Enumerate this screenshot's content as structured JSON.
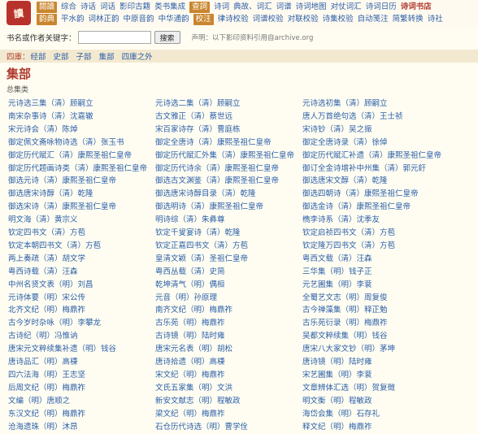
{
  "logo": {
    "text": "讀"
  },
  "nav": {
    "row1": [
      {
        "label": "閱讀",
        "style": "tag"
      },
      {
        "label": "综合",
        "style": ""
      },
      {
        "label": "诗话",
        "style": ""
      },
      {
        "label": "词话",
        "style": ""
      },
      {
        "label": "影印古籍",
        "style": ""
      },
      {
        "label": "类书集成",
        "style": ""
      },
      {
        "label": "查詞",
        "style": "tag"
      },
      {
        "label": "诗词",
        "style": ""
      },
      {
        "label": "典故、词汇",
        "style": ""
      },
      {
        "label": "词谱",
        "style": ""
      },
      {
        "label": "诗词地图",
        "style": ""
      },
      {
        "label": "对仗词汇",
        "style": ""
      },
      {
        "label": "诗词日历",
        "style": ""
      },
      {
        "label": "诗词书店",
        "style": "strong"
      }
    ],
    "row2": [
      {
        "label": "韵典",
        "style": "tag"
      },
      {
        "label": "平水韵",
        "style": ""
      },
      {
        "label": "词林正韵",
        "style": ""
      },
      {
        "label": "中原音韵",
        "style": ""
      },
      {
        "label": "中华通韵",
        "style": ""
      },
      {
        "label": "校注",
        "style": "tag"
      },
      {
        "label": "律诗校验",
        "style": ""
      },
      {
        "label": "词谱校验",
        "style": ""
      },
      {
        "label": "对联校验",
        "style": ""
      },
      {
        "label": "诗集校验",
        "style": ""
      },
      {
        "label": "自动笺注",
        "style": ""
      },
      {
        "label": "简繁转换",
        "style": ""
      },
      {
        "label": "诗社",
        "style": ""
      }
    ]
  },
  "search": {
    "label": "书名或作者关键字：",
    "value": "",
    "button": "搜索",
    "notice": "声明：以下影印资料引用自archive.org"
  },
  "categories": {
    "label": "四庫：",
    "items": [
      "经部",
      "史部",
      "子部",
      "集部",
      "四庫之外"
    ]
  },
  "page": {
    "title": "集部",
    "section": "总集类"
  },
  "books": [
    [
      "元诗选三集（清）顾嗣立",
      "元诗选二集（清）顾嗣立",
      "元诗选初集（清）顾嗣立"
    ],
    [
      "南宋杂事诗（清）沈嘉辙",
      "古文雅正（清）蔡世远",
      "唐人万首绝句选（清）王士祯"
    ],
    [
      "宋元诗会（清）陈焯",
      "宋百家诗存（清）曹庭栋",
      "宋诗钞（清）吴之振"
    ],
    [
      "御定佩文斋咏物诗选（清）张玉书",
      "御定全唐诗（清）康熙圣祖仁皇帝",
      "御定全唐诗录（清）徐倬"
    ],
    [
      "御定历代赋汇（清）康熙圣祖仁皇帝",
      "御定历代赋汇外集（清）康熙圣祖仁皇帝",
      "御定历代赋汇补遗（清）康熙圣祖仁皇帝"
    ],
    [
      "御定历代题画诗类（清）康熙圣祖仁皇帝",
      "御定历代诗余（清）康熙圣祖仁皇帝",
      "御订全金诗增补中州集（清）郭元釪"
    ],
    [
      "御选元诗（清）康熙圣祖仁皇帝",
      "御选古文渊鉴（清）康熙圣祖仁皇帝",
      "御选唐宋文醇（清）乾隆"
    ],
    [
      "御选唐宋诗醇（清）乾隆",
      "御选唐宋诗醇目录（清）乾隆",
      "御选四朝诗（清）康熙圣祖仁皇帝"
    ],
    [
      "御选宋诗（清）康熙圣祖仁皇帝",
      "御选明诗（清）康熙圣祖仁皇帝",
      "御选金诗（清）康熙圣祖仁皇帝"
    ],
    [
      "明文海（清）黄宗义",
      "明诗综（清）朱彝尊",
      "檇李诗系（清）沈季友"
    ],
    [
      "钦定四书文（清）方苞",
      "钦定千叟宴诗（清）乾隆",
      "钦定启祯四书文（清）方苞"
    ],
    [
      "钦定本朝四书文（清）方苞",
      "钦定正嘉四书文（清）方苞",
      "钦定隆万四书文（清）方苞"
    ],
    [
      "两上奏疏（清）胡文学",
      "皇清文颖（清）圣祖仁皇帝",
      "粤西文载（清）汪森"
    ],
    [
      "粤西诗载（清）汪森",
      "粤西丛载（清）史简",
      "三华集（明）钱子正"
    ],
    [
      "中州名贤文表（明）刘昌",
      "乾坤清气（明）偶桓",
      "元艺圃集（明）李蓘"
    ],
    [
      "元诗体要（明）宋公传",
      "元音（明）孙原理",
      "全蜀艺文志（明）周复俊"
    ],
    [
      "北齐文纪（明）梅鼎祚",
      "南齐文纪（明）梅鼎祚",
      "古今禅藻集（明）释正勉"
    ],
    [
      "古今岁时杂咏（明）李攀龙",
      "古乐苑（明）梅鼎祚",
      "古乐苑衍录（明）梅鼎祚"
    ],
    [
      "古诗纪（明）冯惟讷",
      "古诗镜（明）陆时雍",
      "吴都文粹续集（明）钱谷"
    ],
    [
      "唐宋元文粹续集补遗（明）钱谷",
      "唐宋元名表（明）胡松",
      "唐宋八大家文钞（明）茅坤"
    ],
    [
      "唐诗品汇（明）高棅",
      "唐诗拾遗（明）高棅",
      "唐诗镜（明）陆时雍"
    ],
    [
      "四六法海（明）王志坚",
      "宋文纪（明）梅鼎祚",
      "宋艺圃集（明）李蓘"
    ],
    [
      "后周文纪（明）梅鼎祚",
      "文氏五家集（明）文洪",
      "文章辨体汇选（明）贺复徵"
    ],
    [
      "文编（明）唐顺之",
      "新安文献志（明）程敏政",
      "明文衡（明）程敏政"
    ],
    [
      "东汉文纪（明）梅鼎祚",
      "梁文纪（明）梅鼎祚",
      "海岱会集（明）石存礼"
    ],
    [
      "沧海遗珠（明）沐昂",
      "石仓历代诗选（明）曹学佺",
      "释文纪（明）梅鼎祚"
    ]
  ]
}
